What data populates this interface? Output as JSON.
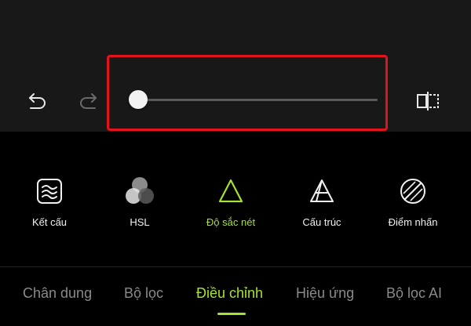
{
  "colors": {
    "accent": "#a6e22e",
    "highlight_box": "#e0141a",
    "background": "#000000",
    "toolbar_bg": "#181818"
  },
  "toolbar": {
    "undo_icon": "undo-icon",
    "redo_icon": "redo-icon",
    "compare_icon": "compare-icon",
    "slider": {
      "value_fraction": 0.0
    }
  },
  "tools": [
    {
      "label": "Kết cấu",
      "icon": "texture-icon",
      "active": false
    },
    {
      "label": "HSL",
      "icon": "hsl-icon",
      "active": false
    },
    {
      "label": "Độ sắc nét",
      "icon": "sharpness-triangle-icon",
      "active": true
    },
    {
      "label": "Cấu trúc",
      "icon": "structure-triangle-icon",
      "active": false
    },
    {
      "label": "Điểm nhấn",
      "icon": "highlight-circle-icon",
      "active": false
    }
  ],
  "tabs": [
    {
      "label": "Chân dung",
      "active": false
    },
    {
      "label": "Bộ lọc",
      "active": false
    },
    {
      "label": "Điều chỉnh",
      "active": true
    },
    {
      "label": "Hiệu ứng",
      "active": false
    },
    {
      "label": "Bộ lọc AI",
      "active": false
    }
  ]
}
